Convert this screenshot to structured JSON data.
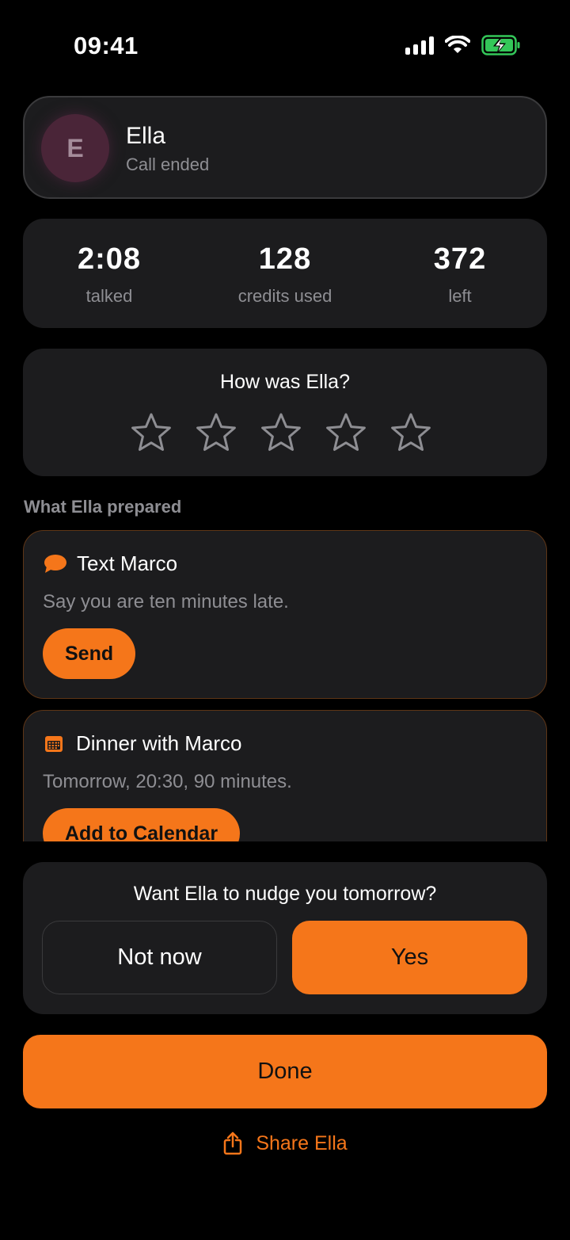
{
  "status_bar": {
    "time": "09:41",
    "icons": [
      "signal-icon",
      "wifi-icon",
      "battery-charging-icon"
    ]
  },
  "contact": {
    "initial": "E",
    "name": "Ella",
    "status": "Call ended"
  },
  "stats": [
    {
      "value": "2:08",
      "label": "talked"
    },
    {
      "value": "128",
      "label": "credits used"
    },
    {
      "value": "372",
      "label": "left"
    }
  ],
  "rating": {
    "question": "How was Ella?",
    "stars_total": 5,
    "stars_selected": 0
  },
  "prepared": {
    "section_label": "What Ella prepared",
    "items": [
      {
        "icon": "message-bubble-icon",
        "title": "Text Marco",
        "description": "Say you are ten minutes late.",
        "action": "Send"
      },
      {
        "icon": "calendar-icon",
        "title": "Dinner with Marco",
        "description": "Tomorrow, 20:30, 90 minutes.",
        "action": "Add to Calendar"
      }
    ]
  },
  "nudge": {
    "question": "Want Ella to nudge you tomorrow?",
    "no_label": "Not now",
    "yes_label": "Yes"
  },
  "done_label": "Done",
  "share_label": "Share Ella",
  "colors": {
    "accent": "#f5761a",
    "card": "#1c1c1e",
    "muted": "#8e8e93",
    "background": "#000000",
    "battery": "#34c759"
  }
}
